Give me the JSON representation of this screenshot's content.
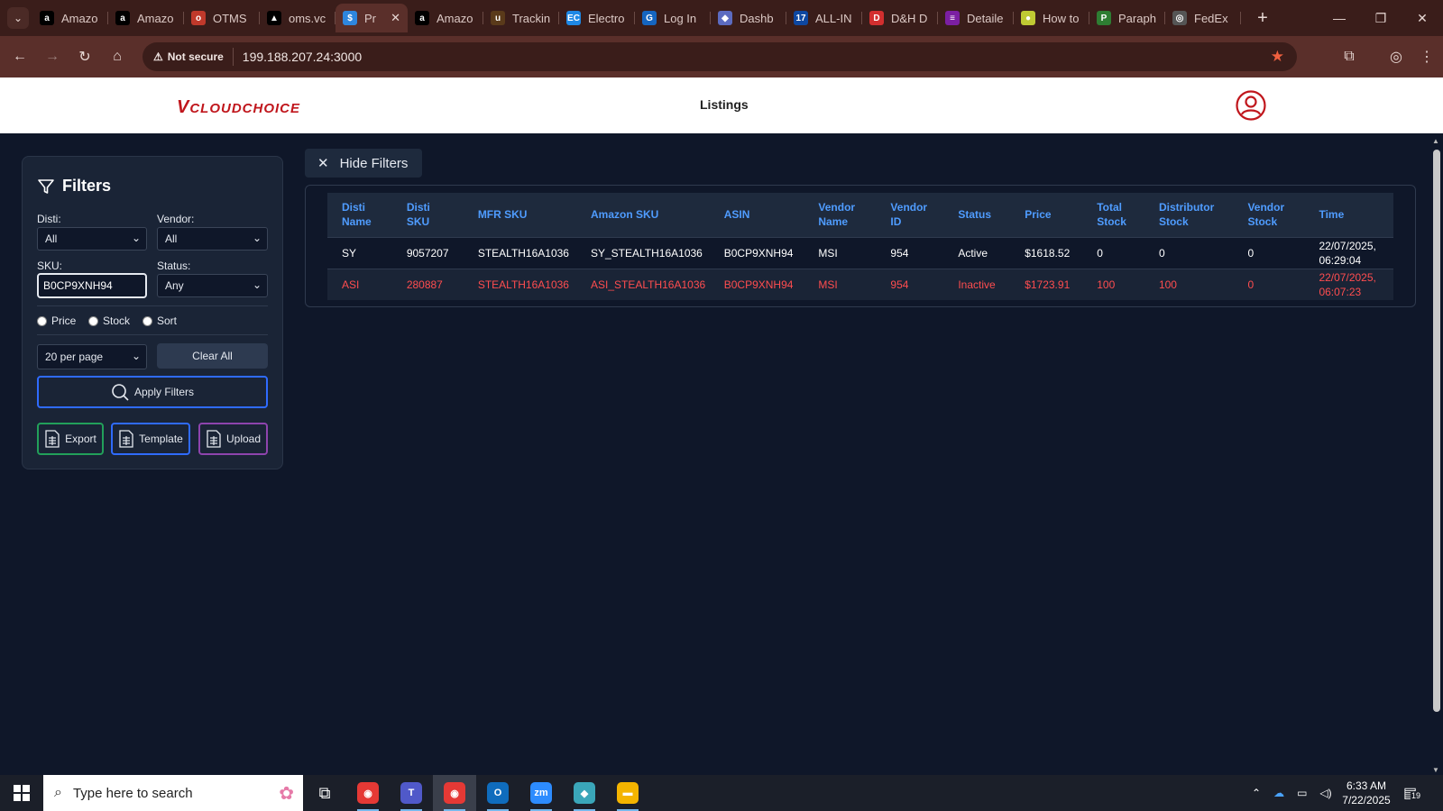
{
  "browser": {
    "tabs": [
      {
        "label": "Amazo",
        "fav": "a",
        "color": "#000000"
      },
      {
        "label": "Amazo",
        "fav": "a",
        "color": "#000000"
      },
      {
        "label": "OTMS",
        "fav": "o",
        "color": "#c0392b"
      },
      {
        "label": "oms.vc",
        "fav": "▲",
        "color": "#000000"
      },
      {
        "label": "Pr",
        "fav": "$",
        "color": "#2e86de",
        "active": true
      },
      {
        "label": "Amazo",
        "fav": "a",
        "color": "#000000"
      },
      {
        "label": "Trackin",
        "fav": "u",
        "color": "#5a3a1a"
      },
      {
        "label": "Electro",
        "fav": "EC",
        "color": "#1e88e5"
      },
      {
        "label": "Log In",
        "fav": "G",
        "color": "#1565c0"
      },
      {
        "label": "Dashb",
        "fav": "◆",
        "color": "#5c6bc0"
      },
      {
        "label": "ALL-IN",
        "fav": "17",
        "color": "#0d47a1"
      },
      {
        "label": "D&H D",
        "fav": "D",
        "color": "#d32f2f"
      },
      {
        "label": "Detaile",
        "fav": "≡",
        "color": "#7b1fa2"
      },
      {
        "label": "How to",
        "fav": "●",
        "color": "#c0ca33"
      },
      {
        "label": "Paraph",
        "fav": "P",
        "color": "#2e7d32"
      },
      {
        "label": "FedEx",
        "fav": "◎",
        "color": "#555555"
      }
    ],
    "new_tab": "+",
    "url": "199.188.207.24:3000",
    "not_secure_label": "Not secure"
  },
  "app": {
    "logo": "CLOUDCHOICE",
    "logo_v": "V",
    "nav_title": "Listings"
  },
  "filters": {
    "title": "Filters",
    "disti_label": "Disti:",
    "disti_value": "All",
    "vendor_label": "Vendor:",
    "vendor_value": "All",
    "sku_label": "SKU:",
    "sku_value": "B0CP9XNH94",
    "status_label": "Status:",
    "status_value": "Any",
    "radio_price": "Price",
    "radio_stock": "Stock",
    "radio_sort": "Sort",
    "per_page": "20 per page",
    "clear_all": "Clear All",
    "apply": "Apply Filters",
    "export": "Export",
    "template": "Template",
    "upload": "Upload",
    "colors": {
      "export": "#22a05a",
      "template": "#2f6bff",
      "upload": "#8e44ad"
    }
  },
  "hide_filters_label": "Hide Filters",
  "table": {
    "headers": [
      [
        "Disti",
        "Name"
      ],
      [
        "Disti",
        "SKU"
      ],
      [
        "MFR SKU",
        ""
      ],
      [
        "Amazon SKU",
        ""
      ],
      [
        "ASIN",
        ""
      ],
      [
        "Vendor",
        "Name"
      ],
      [
        "Vendor",
        "ID"
      ],
      [
        "Status",
        ""
      ],
      [
        "Price",
        ""
      ],
      [
        "Total",
        "Stock"
      ],
      [
        "Distributor",
        "Stock"
      ],
      [
        "Vendor",
        "Stock"
      ],
      [
        "Time",
        ""
      ]
    ],
    "rows": [
      {
        "state": "active",
        "cells": [
          "SY",
          "9057207",
          "STEALTH16A1036",
          "SY_STEALTH16A1036",
          "B0CP9XNH94",
          "MSI",
          "954",
          "Active",
          "$1618.52",
          "0",
          "0",
          "0",
          "22/07/2025,",
          "06:29:04"
        ]
      },
      {
        "state": "inactive",
        "cells": [
          "ASI",
          "280887",
          "STEALTH16A1036",
          "ASI_STEALTH16A1036",
          "B0CP9XNH94",
          "MSI",
          "954",
          "Inactive",
          "$1723.91",
          "100",
          "100",
          "0",
          "22/07/2025,",
          "06:07:23"
        ]
      }
    ]
  },
  "taskbar": {
    "search_placeholder": "Type here to search",
    "time": "6:33 AM",
    "date": "7/22/2025",
    "notif_count": "19",
    "apps": [
      {
        "name": "task-view",
        "glyph": "⧉",
        "color": "transparent"
      },
      {
        "name": "chrome",
        "glyph": "◉",
        "color": "#e53935"
      },
      {
        "name": "teams",
        "glyph": "T",
        "color": "#5059c9"
      },
      {
        "name": "chrome-profile",
        "glyph": "◉",
        "color": "#e53935"
      },
      {
        "name": "outlook",
        "glyph": "O",
        "color": "#0f6cbd"
      },
      {
        "name": "zoom",
        "glyph": "zm",
        "color": "#2d8cff"
      },
      {
        "name": "app-diamond",
        "glyph": "◆",
        "color": "#3aa6b9"
      },
      {
        "name": "file-explorer",
        "glyph": "▬",
        "color": "#f4b400"
      }
    ]
  }
}
